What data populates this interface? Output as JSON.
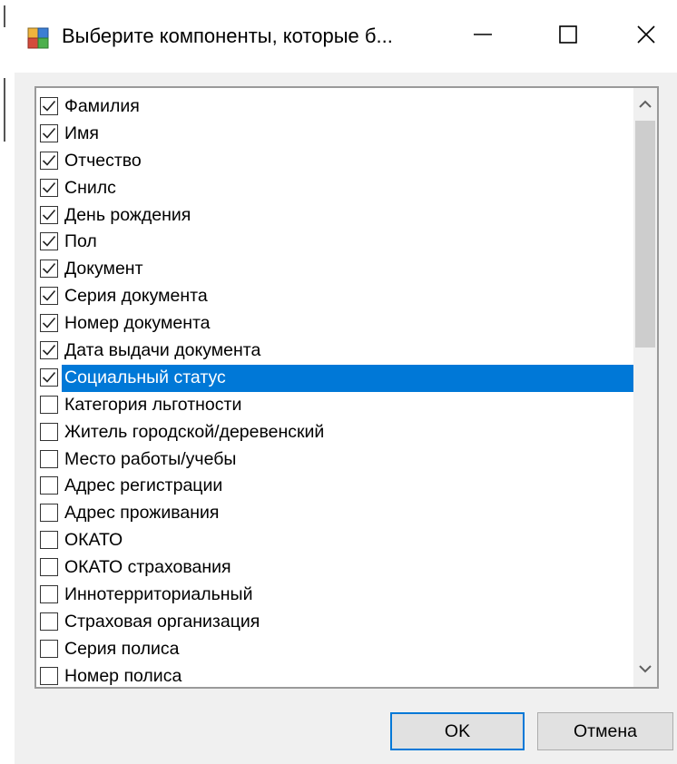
{
  "window": {
    "title": "Выберите компоненты, которые б..."
  },
  "icons": {
    "app": "app-window-icon",
    "minimize": "minimize-icon",
    "maximize": "maximize-icon",
    "close": "close-icon",
    "checkmark": "checkmark-icon",
    "scroll_up": "chevron-up-icon",
    "scroll_down": "chevron-down-icon"
  },
  "colors": {
    "selection": "#0078d7",
    "default_button_border": "#0078d7",
    "dialog_background": "#f0f0f0"
  },
  "list": {
    "items": [
      {
        "label": "Фамилия",
        "checked": true
      },
      {
        "label": "Имя",
        "checked": true
      },
      {
        "label": "Отчество",
        "checked": true
      },
      {
        "label": "Снилс",
        "checked": true
      },
      {
        "label": "День рождения",
        "checked": true
      },
      {
        "label": "Пол",
        "checked": true
      },
      {
        "label": "Документ",
        "checked": true
      },
      {
        "label": "Серия документа",
        "checked": true
      },
      {
        "label": "Номер документа",
        "checked": true
      },
      {
        "label": "Дата выдачи документа",
        "checked": true
      },
      {
        "label": "Социальный статус",
        "checked": true,
        "selected": true
      },
      {
        "label": "Категория льготности",
        "checked": false
      },
      {
        "label": "Житель городской/деревенский",
        "checked": false
      },
      {
        "label": "Место работы/учебы",
        "checked": false
      },
      {
        "label": "Адрес регистрации",
        "checked": false
      },
      {
        "label": "Адрес проживания",
        "checked": false
      },
      {
        "label": "ОКАТО",
        "checked": false
      },
      {
        "label": "ОКАТО страхования",
        "checked": false
      },
      {
        "label": "Иннотерриториальный",
        "checked": false
      },
      {
        "label": "Страховая организация",
        "checked": false
      },
      {
        "label": "Серия полиса",
        "checked": false
      },
      {
        "label": "Номер полиса",
        "checked": false
      }
    ]
  },
  "buttons": {
    "ok_label": "OK",
    "cancel_label": "Отмена"
  }
}
